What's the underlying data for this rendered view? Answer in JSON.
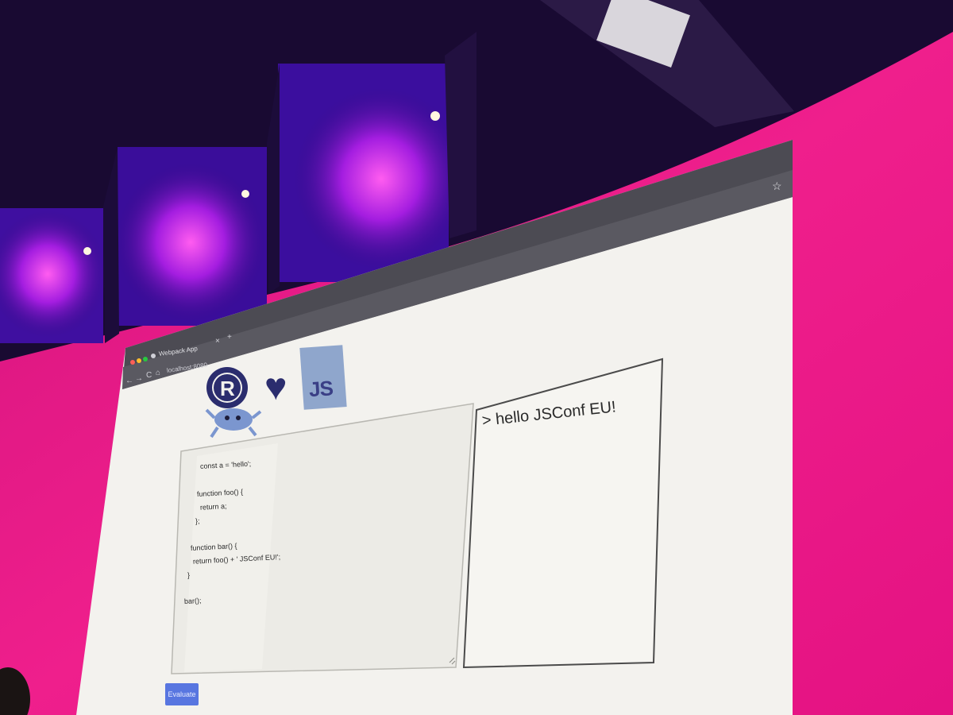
{
  "browser": {
    "tab_title": "Webpack App",
    "tab_close": "×",
    "new_tab": "+",
    "url": "localhost:8080",
    "back": "←",
    "forward": "→",
    "reload": "C",
    "home": "⌂",
    "bookmark": "☆"
  },
  "logos": {
    "rust_letter": "R",
    "heart": "♥",
    "js": "JS"
  },
  "editor": {
    "lines": [
      "const a = 'hello';",
      "",
      "function foo() {",
      "  return a;",
      "};",
      "",
      "function bar() {",
      "  return foo() + ' JSConf EU!';",
      "}",
      "",
      "bar();"
    ]
  },
  "output": {
    "text": "> hello JSConf EU!"
  },
  "evaluate_label": "Evaluate",
  "colors": {
    "stage_magenta": "#e8157f",
    "screen_bg": "#f3f2ee",
    "chrome_bg": "#4c4b53",
    "button_blue": "#5876e0",
    "js_yellow_replaced": "#8fa6cc"
  }
}
